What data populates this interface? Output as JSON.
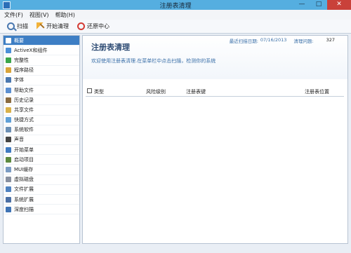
{
  "window": {
    "title": "注册表清理",
    "minimize": "—",
    "maximize": "□",
    "close": "✕"
  },
  "menu": [
    "文件(F)",
    "视图(V)",
    "帮助(H)"
  ],
  "toolbar": {
    "scan": "扫描",
    "clean": "开始清理",
    "restore": "还原中心"
  },
  "sidebar": [
    {
      "label": "概要",
      "color": "#3d7ec4"
    },
    {
      "label": "ActiveX和组件",
      "color": "#4a8fd8"
    },
    {
      "label": "完整性",
      "color": "#3aa64a"
    },
    {
      "label": "程序路径",
      "color": "#d9a43a"
    },
    {
      "label": "字体",
      "color": "#4a78b0"
    },
    {
      "label": "帮助文件",
      "color": "#5b8fd1"
    },
    {
      "label": "历史记录",
      "color": "#8a6b40"
    },
    {
      "label": "共享文件",
      "color": "#d9b14a"
    },
    {
      "label": "快捷方式",
      "color": "#5fa0d8"
    },
    {
      "label": "系统软件",
      "color": "#6b8fb5"
    },
    {
      "label": "声音",
      "color": "#444444"
    },
    {
      "label": "开始菜单",
      "color": "#3f7ac1"
    },
    {
      "label": "启动项目",
      "color": "#5c8a3f"
    },
    {
      "label": "MUI缓存",
      "color": "#7a9bc3"
    },
    {
      "label": "虚拟磁盘",
      "color": "#8890a0"
    },
    {
      "label": "文件扩展",
      "color": "#4f82c0"
    },
    {
      "label": "系统扩展",
      "color": "#4a6fa5"
    },
    {
      "label": "深度扫描",
      "color": "#3f74b5"
    }
  ],
  "main": {
    "title": "注册表清理",
    "description": "欢迎使用注册表清理.在菜单栏中点击扫描，检测你的系统",
    "last_scan_label": "最近扫描日期:",
    "last_scan_date": "07/16/2013",
    "issues_label": "清理问题:",
    "issues_count": "327"
  },
  "columns": [
    "类型",
    "风险级别",
    "注册表键",
    "注册表位置"
  ]
}
